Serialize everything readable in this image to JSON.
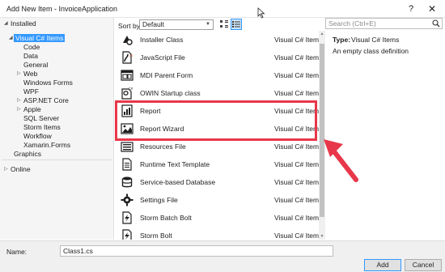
{
  "window": {
    "title": "Add New Item - InvoiceApplication",
    "help": "?",
    "close": "✕"
  },
  "left": {
    "installed_label": "Installed",
    "tree": [
      {
        "label": "Visual C# Items",
        "selected": true
      },
      {
        "label": "Code"
      },
      {
        "label": "Data"
      },
      {
        "label": "General"
      },
      {
        "label": "Web"
      },
      {
        "label": "Windows Forms"
      },
      {
        "label": "WPF"
      },
      {
        "label": "ASP.NET Core"
      },
      {
        "label": "Apple"
      },
      {
        "label": "SQL Server"
      },
      {
        "label": "Storm Items"
      },
      {
        "label": "Workflow"
      },
      {
        "label": "Xamarin.Forms"
      },
      {
        "label": "Graphics"
      }
    ],
    "online_label": "Online"
  },
  "toolbar": {
    "sort_label": "Sort by:",
    "sort_value": "Default",
    "sort_chevron": "▼"
  },
  "items": [
    {
      "name": "Installer Class",
      "category": "Visual C# Items",
      "icon": "installer-icon"
    },
    {
      "name": "JavaScript File",
      "category": "Visual C# Items",
      "icon": "javascript-file-icon"
    },
    {
      "name": "MDI Parent Form",
      "category": "Visual C# Items",
      "icon": "mdi-form-icon"
    },
    {
      "name": "OWIN Startup class",
      "category": "Visual C# Items",
      "icon": "owin-class-icon"
    },
    {
      "name": "Report",
      "category": "Visual C# Items",
      "icon": "report-icon"
    },
    {
      "name": "Report Wizard",
      "category": "Visual C# Items",
      "icon": "report-wizard-icon"
    },
    {
      "name": "Resources File",
      "category": "Visual C# Items",
      "icon": "resources-file-icon"
    },
    {
      "name": "Runtime Text Template",
      "category": "Visual C# Items",
      "icon": "text-template-icon"
    },
    {
      "name": "Service-based Database",
      "category": "Visual C# Items",
      "icon": "database-icon"
    },
    {
      "name": "Settings File",
      "category": "Visual C# Items",
      "icon": "settings-gear-icon"
    },
    {
      "name": "Storm Batch Bolt",
      "category": "Visual C# Items",
      "icon": "storm-batch-bolt-icon"
    },
    {
      "name": "Storm Bolt",
      "category": "Visual C# Items",
      "icon": "storm-bolt-icon"
    }
  ],
  "search": {
    "placeholder": "Search (Ctrl+E)"
  },
  "details": {
    "type_label": "Type:",
    "type_value": "Visual C# Items",
    "description": "An empty class definition"
  },
  "footer": {
    "name_label": "Name:",
    "name_value": "Class1.cs",
    "add_label": "Add",
    "cancel_label": "Cancel"
  },
  "colors": {
    "highlight": "#e8374a",
    "selection": "#3399ff"
  }
}
